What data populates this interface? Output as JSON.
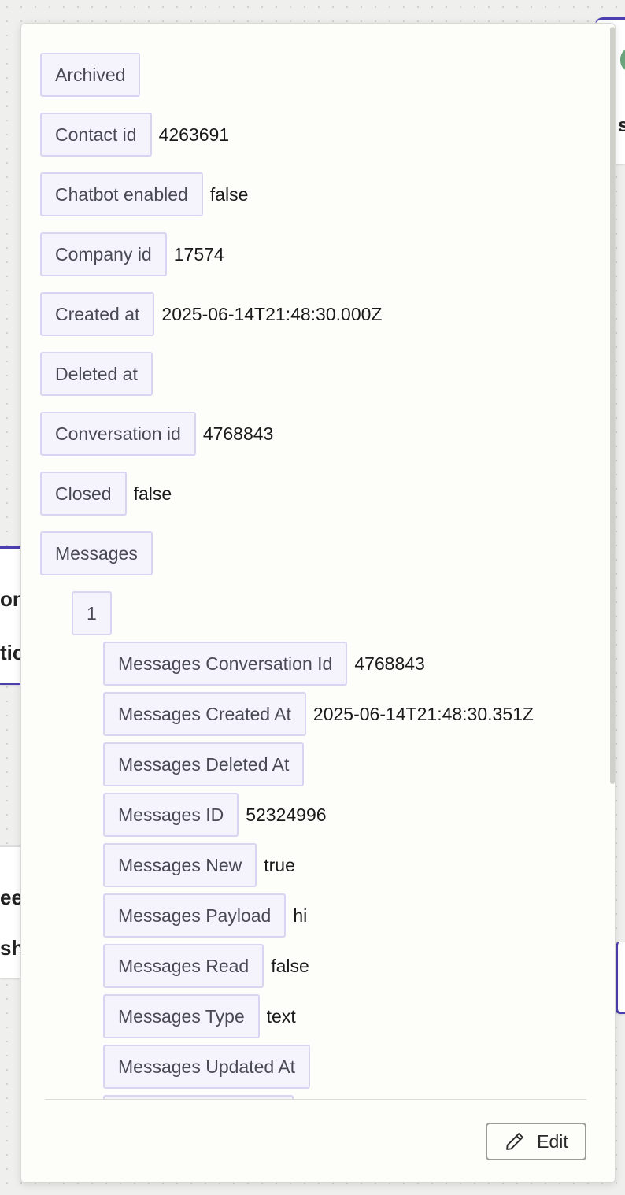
{
  "background": {
    "left_fragments": [
      "on",
      "tic",
      "ee",
      "sh"
    ],
    "right_fragment": "s"
  },
  "fields": [
    {
      "label": "Archived",
      "value": ""
    },
    {
      "label": "Contact id",
      "value": "4263691"
    },
    {
      "label": "Chatbot enabled",
      "value": "false"
    },
    {
      "label": "Company id",
      "value": "17574"
    },
    {
      "label": "Created at",
      "value": "2025-06-14T21:48:30.000Z"
    },
    {
      "label": "Deleted at",
      "value": ""
    },
    {
      "label": "Conversation id",
      "value": "4768843"
    },
    {
      "label": "Closed",
      "value": "false"
    },
    {
      "label": "Messages",
      "value": ""
    }
  ],
  "message_index": "1",
  "message_fields": [
    {
      "label": "Messages Conversation Id",
      "value": "4768843"
    },
    {
      "label": "Messages Created At",
      "value": "2025-06-14T21:48:30.351Z"
    },
    {
      "label": "Messages Deleted At",
      "value": ""
    },
    {
      "label": "Messages ID",
      "value": "52324996"
    },
    {
      "label": "Messages New",
      "value": "true"
    },
    {
      "label": "Messages Payload",
      "value": "hi"
    },
    {
      "label": "Messages Read",
      "value": "false"
    },
    {
      "label": "Messages Type",
      "value": "text"
    },
    {
      "label": "Messages Updated At",
      "value": ""
    }
  ],
  "edit_label": "Edit",
  "colors": {
    "tag_bg": "#f5f4fd",
    "tag_border": "#d7d5f2",
    "accent": "#4c3fb0"
  }
}
